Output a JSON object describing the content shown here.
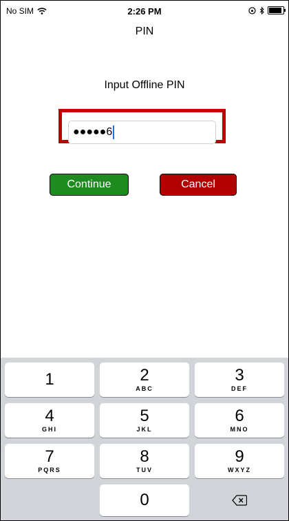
{
  "status_bar": {
    "carrier": "No SIM",
    "time": "2:26 PM"
  },
  "nav": {
    "title": "PIN"
  },
  "form": {
    "prompt": "Input Offline PIN",
    "pin_value": "●●●●●6",
    "continue_label": "Continue",
    "cancel_label": "Cancel"
  },
  "keypad": {
    "keys": [
      {
        "digit": "1",
        "letters": ""
      },
      {
        "digit": "2",
        "letters": "ABC"
      },
      {
        "digit": "3",
        "letters": "DEF"
      },
      {
        "digit": "4",
        "letters": "GHI"
      },
      {
        "digit": "5",
        "letters": "JKL"
      },
      {
        "digit": "6",
        "letters": "MNO"
      },
      {
        "digit": "7",
        "letters": "PQRS"
      },
      {
        "digit": "8",
        "letters": "TUV"
      },
      {
        "digit": "9",
        "letters": "WXYZ"
      },
      {
        "digit": "0",
        "letters": ""
      }
    ],
    "delete_icon": "backspace-icon"
  },
  "colors": {
    "highlight": "#c00000",
    "continue": "#1f8a1f",
    "cancel": "#b20000",
    "caret": "#1f6fe0"
  },
  "battery_level": 1.0
}
